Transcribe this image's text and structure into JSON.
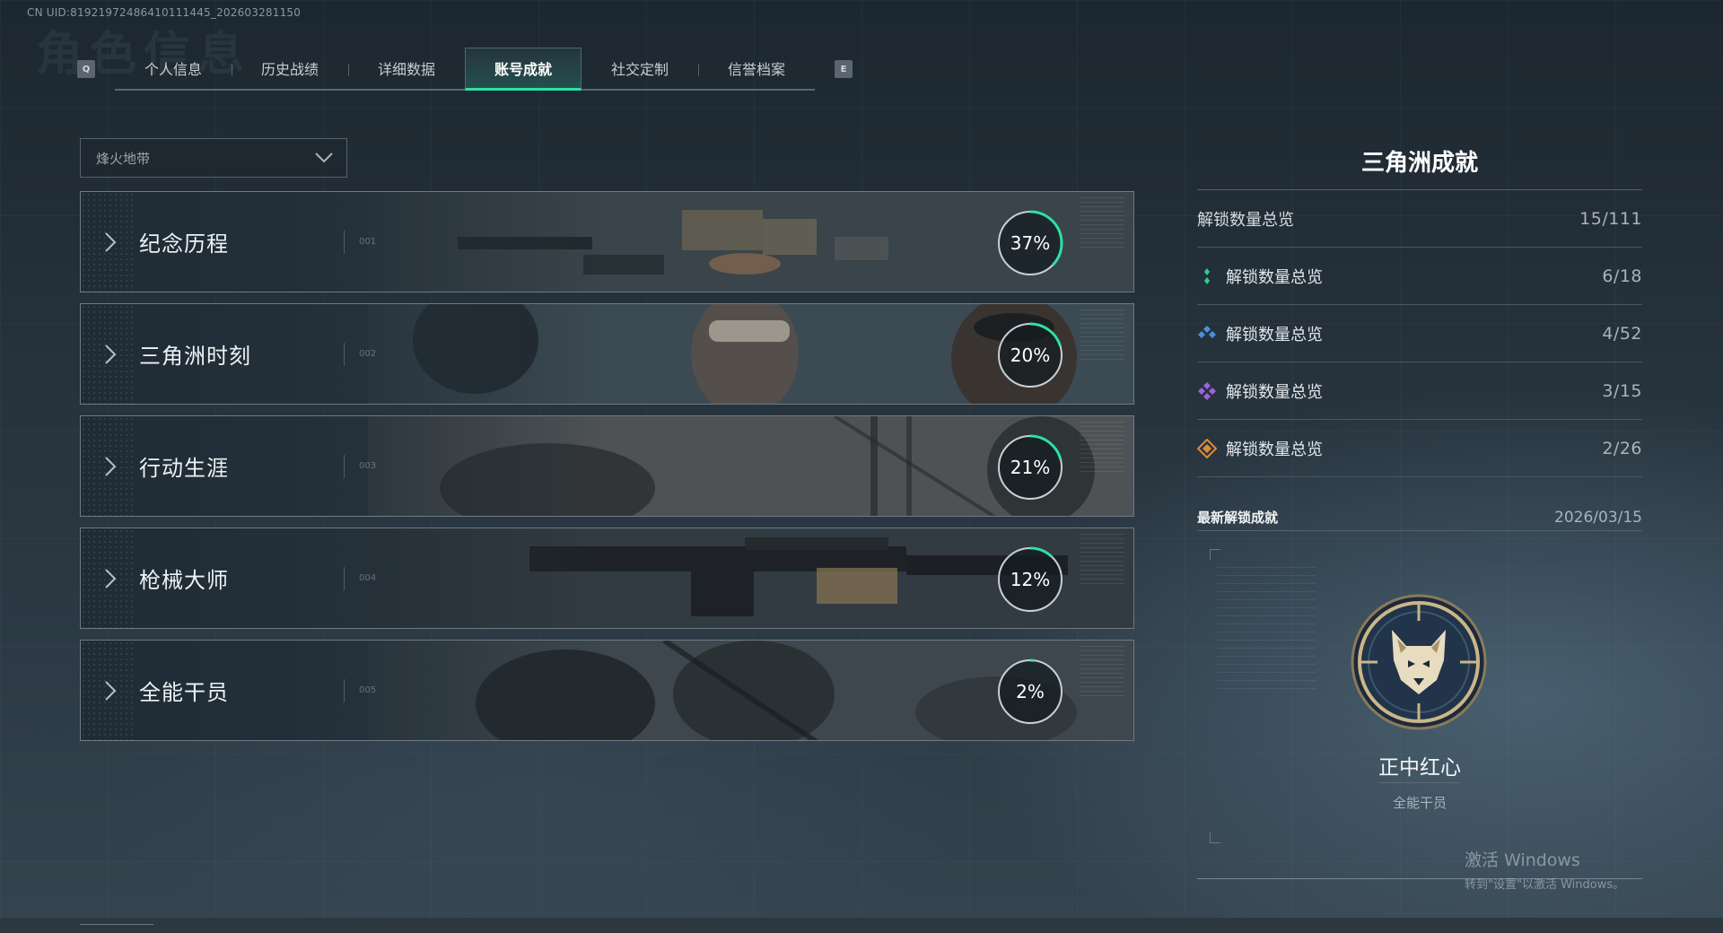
{
  "header": {
    "uid": "CN UID:819219724864101114​45_202603281150",
    "bg_title": "角色信息"
  },
  "tabs": {
    "left_key": "Q",
    "right_key": "E",
    "items": [
      {
        "label": "个人信息",
        "active": false
      },
      {
        "label": "历史战绩",
        "active": false
      },
      {
        "label": "详细数据",
        "active": false
      },
      {
        "label": "账号成就",
        "active": true
      },
      {
        "label": "社交定制",
        "active": false
      },
      {
        "label": "信誉档案",
        "active": false
      }
    ]
  },
  "mode_select": {
    "value": "烽火地带",
    "icon": "chevron-down-icon"
  },
  "categories": [
    {
      "title": "纪念历程",
      "num": "001",
      "progress_label": "37%",
      "progress": 0.37
    },
    {
      "title": "三角洲时刻",
      "num": "002",
      "progress_label": "20%",
      "progress": 0.2
    },
    {
      "title": "行动生涯",
      "num": "003",
      "progress_label": "21%",
      "progress": 0.21
    },
    {
      "title": "枪械大师",
      "num": "004",
      "progress_label": "12%",
      "progress": 0.12
    },
    {
      "title": "全能干员",
      "num": "005",
      "progress_label": "2%",
      "progress": 0.02
    }
  ],
  "colors": {
    "accent": "#2ee0a0",
    "tier_green": "#2fcf8c",
    "tier_blue": "#4a8fe0",
    "tier_purple": "#9a63e0",
    "tier_orange": "#e08a3a"
  },
  "panel": {
    "title": "三角洲成就",
    "total": {
      "label": "解锁数量总览",
      "value": "15/111"
    },
    "tiers": [
      {
        "label": "解锁数量总览",
        "value": "6/18",
        "icon": "green-gem-icon"
      },
      {
        "label": "解锁数量总览",
        "value": "4/52",
        "icon": "blue-gem-icon"
      },
      {
        "label": "解锁数量总览",
        "value": "3/15",
        "icon": "purple-gem-icon"
      },
      {
        "label": "解锁数量总览",
        "value": "2/26",
        "icon": "orange-gem-icon"
      }
    ],
    "recent": {
      "title": "最新解锁成就",
      "date": "2026/03/15",
      "achievement_name": "正中红心",
      "achievement_category": "全能干员",
      "badge_icon": "wolf-badge-icon"
    }
  },
  "watermark": {
    "line1": "激活 Windows",
    "line2": "转到\"设置\"以激活 Windows。"
  }
}
